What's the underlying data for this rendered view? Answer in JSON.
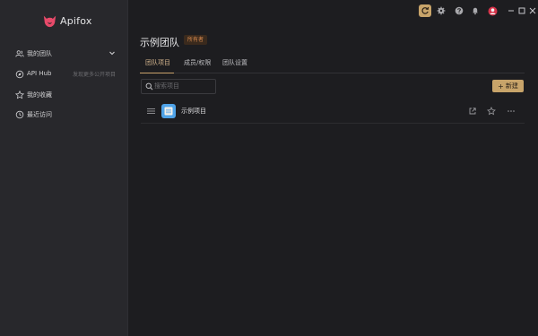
{
  "app": {
    "name": "Apifox",
    "brand_color": "#e84a6a"
  },
  "sidebar": {
    "items": [
      {
        "label": "我的团队",
        "icon": "team-icon"
      },
      {
        "label": "API Hub",
        "icon": "compass-icon",
        "hint": "发现更多公开项目"
      },
      {
        "label": "我的收藏",
        "icon": "star-icon"
      },
      {
        "label": "最近访问",
        "icon": "clock-icon"
      }
    ]
  },
  "topbar": {
    "icons": [
      "sync-icon",
      "settings-icon",
      "help-icon",
      "bell-icon",
      "avatar"
    ],
    "window_controls": [
      "minimize-icon",
      "maximize-icon",
      "close-icon"
    ]
  },
  "team": {
    "title": "示例团队",
    "role_badge": "所有者"
  },
  "tabs": [
    {
      "label": "团队项目",
      "active": true
    },
    {
      "label": "成员/权限",
      "active": false
    },
    {
      "label": "团队设置",
      "active": false
    }
  ],
  "search": {
    "placeholder": "搜索项目",
    "value": ""
  },
  "actions": {
    "new_label": "新建",
    "accent": "#c8a46a"
  },
  "projects": [
    {
      "name": "示例项目"
    }
  ]
}
